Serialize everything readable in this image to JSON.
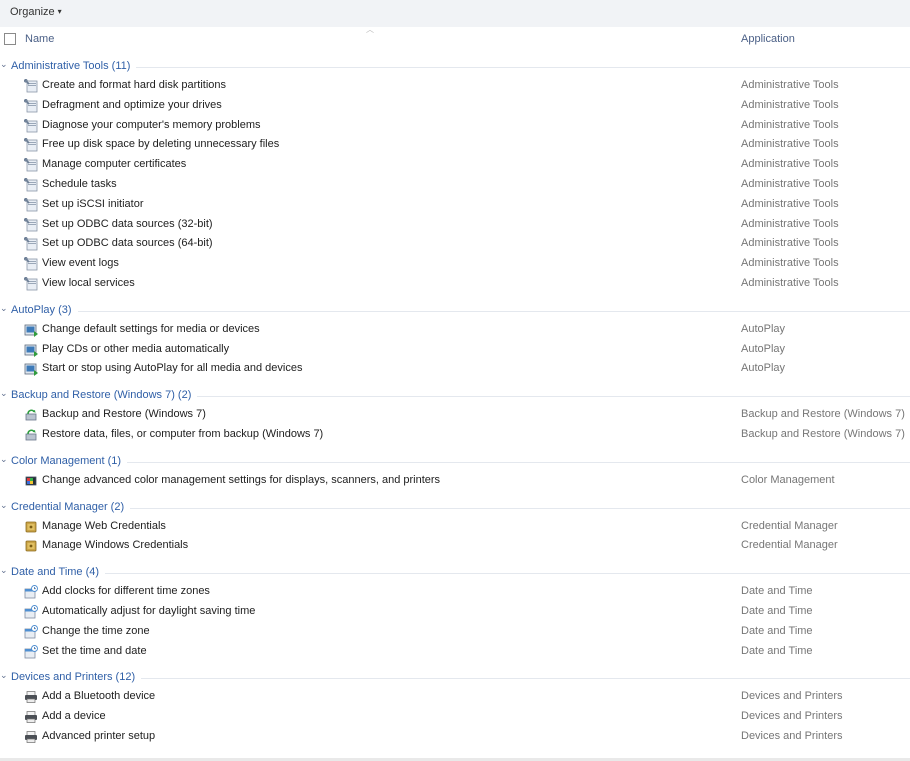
{
  "toolbar": {
    "organize_label": "Organize",
    "organize_caret": "▾"
  },
  "columns": {
    "name": "Name",
    "application": "Application"
  },
  "groups": [
    {
      "title": "Administrative Tools (11)",
      "icon": "admin-tools-icon",
      "items": [
        {
          "label": "Create and format hard disk partitions",
          "app": "Administrative Tools"
        },
        {
          "label": "Defragment and optimize your drives",
          "app": "Administrative Tools"
        },
        {
          "label": "Diagnose your computer's memory problems",
          "app": "Administrative Tools"
        },
        {
          "label": "Free up disk space by deleting unnecessary files",
          "app": "Administrative Tools"
        },
        {
          "label": "Manage computer certificates",
          "app": "Administrative Tools"
        },
        {
          "label": "Schedule tasks",
          "app": "Administrative Tools"
        },
        {
          "label": "Set up iSCSI initiator",
          "app": "Administrative Tools"
        },
        {
          "label": "Set up ODBC data sources (32-bit)",
          "app": "Administrative Tools"
        },
        {
          "label": "Set up ODBC data sources (64-bit)",
          "app": "Administrative Tools"
        },
        {
          "label": "View event logs",
          "app": "Administrative Tools"
        },
        {
          "label": "View local services",
          "app": "Administrative Tools"
        }
      ]
    },
    {
      "title": "AutoPlay (3)",
      "icon": "autoplay-icon",
      "items": [
        {
          "label": "Change default settings for media or devices",
          "app": "AutoPlay"
        },
        {
          "label": "Play CDs or other media automatically",
          "app": "AutoPlay"
        },
        {
          "label": "Start or stop using AutoPlay for all media and devices",
          "app": "AutoPlay"
        }
      ]
    },
    {
      "title": "Backup and Restore (Windows 7) (2)",
      "icon": "backup-restore-icon",
      "items": [
        {
          "label": "Backup and Restore (Windows 7)",
          "app": "Backup and Restore (Windows 7)"
        },
        {
          "label": "Restore data, files, or computer from backup (Windows 7)",
          "app": "Backup and Restore (Windows 7)"
        }
      ]
    },
    {
      "title": "Color Management (1)",
      "icon": "color-management-icon",
      "items": [
        {
          "label": "Change advanced color management settings for displays, scanners, and printers",
          "app": "Color Management"
        }
      ]
    },
    {
      "title": "Credential Manager (2)",
      "icon": "credential-vault-icon",
      "items": [
        {
          "label": "Manage Web Credentials",
          "app": "Credential Manager"
        },
        {
          "label": "Manage Windows Credentials",
          "app": "Credential Manager"
        }
      ]
    },
    {
      "title": "Date and Time (4)",
      "icon": "date-time-icon",
      "items": [
        {
          "label": "Add clocks for different time zones",
          "app": "Date and Time"
        },
        {
          "label": "Automatically adjust for daylight saving time",
          "app": "Date and Time"
        },
        {
          "label": "Change the time zone",
          "app": "Date and Time"
        },
        {
          "label": "Set the time and date",
          "app": "Date and Time"
        }
      ]
    },
    {
      "title": "Devices and Printers (12)",
      "icon": "printer-icon",
      "items": [
        {
          "label": "Add a Bluetooth device",
          "app": "Devices and Printers"
        },
        {
          "label": "Add a device",
          "app": "Devices and Printers"
        },
        {
          "label": "Advanced printer setup",
          "app": "Devices and Printers"
        }
      ]
    }
  ],
  "colors": {
    "group_title": "#2f5fa7",
    "column_header": "#4a5f86",
    "app_text": "#767676",
    "toolbar_bg": "#f1f3f6"
  }
}
